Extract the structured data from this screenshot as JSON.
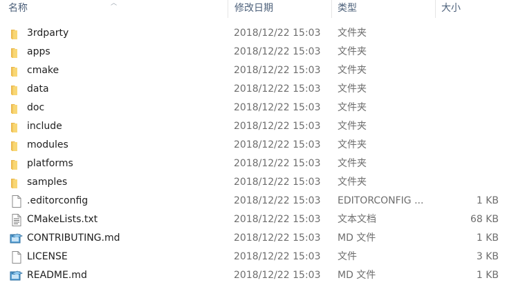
{
  "columns": {
    "name": "名称",
    "date": "修改日期",
    "type": "类型",
    "size": "大小"
  },
  "files": [
    {
      "name": "3rdparty",
      "date": "2018/12/22 15:03",
      "type": "文件夹",
      "size": "",
      "icon": "folder-icon"
    },
    {
      "name": "apps",
      "date": "2018/12/22 15:03",
      "type": "文件夹",
      "size": "",
      "icon": "folder-icon"
    },
    {
      "name": "cmake",
      "date": "2018/12/22 15:03",
      "type": "文件夹",
      "size": "",
      "icon": "folder-icon"
    },
    {
      "name": "data",
      "date": "2018/12/22 15:03",
      "type": "文件夹",
      "size": "",
      "icon": "folder-icon"
    },
    {
      "name": "doc",
      "date": "2018/12/22 15:03",
      "type": "文件夹",
      "size": "",
      "icon": "folder-icon"
    },
    {
      "name": "include",
      "date": "2018/12/22 15:03",
      "type": "文件夹",
      "size": "",
      "icon": "folder-icon"
    },
    {
      "name": "modules",
      "date": "2018/12/22 15:03",
      "type": "文件夹",
      "size": "",
      "icon": "folder-icon"
    },
    {
      "name": "platforms",
      "date": "2018/12/22 15:03",
      "type": "文件夹",
      "size": "",
      "icon": "folder-icon"
    },
    {
      "name": "samples",
      "date": "2018/12/22 15:03",
      "type": "文件夹",
      "size": "",
      "icon": "folder-icon"
    },
    {
      "name": ".editorconfig",
      "date": "2018/12/22 15:03",
      "type": "EDITORCONFIG ...",
      "size": "1 KB",
      "icon": "file-icon"
    },
    {
      "name": "CMakeLists.txt",
      "date": "2018/12/22 15:03",
      "type": "文本文档",
      "size": "68 KB",
      "icon": "text-file-icon"
    },
    {
      "name": "CONTRIBUTING.md",
      "date": "2018/12/22 15:03",
      "type": "MD 文件",
      "size": "1 KB",
      "icon": "md-file-icon"
    },
    {
      "name": "LICENSE",
      "date": "2018/12/22 15:03",
      "type": "文件",
      "size": "3 KB",
      "icon": "file-icon"
    },
    {
      "name": "README.md",
      "date": "2018/12/22 15:03",
      "type": "MD 文件",
      "size": "1 KB",
      "icon": "md-file-icon"
    }
  ],
  "colors": {
    "folder": "#f8d775",
    "folder_dark": "#e8b54a",
    "header_text": "#4c607a",
    "secondary_text": "#6d6d6d"
  }
}
